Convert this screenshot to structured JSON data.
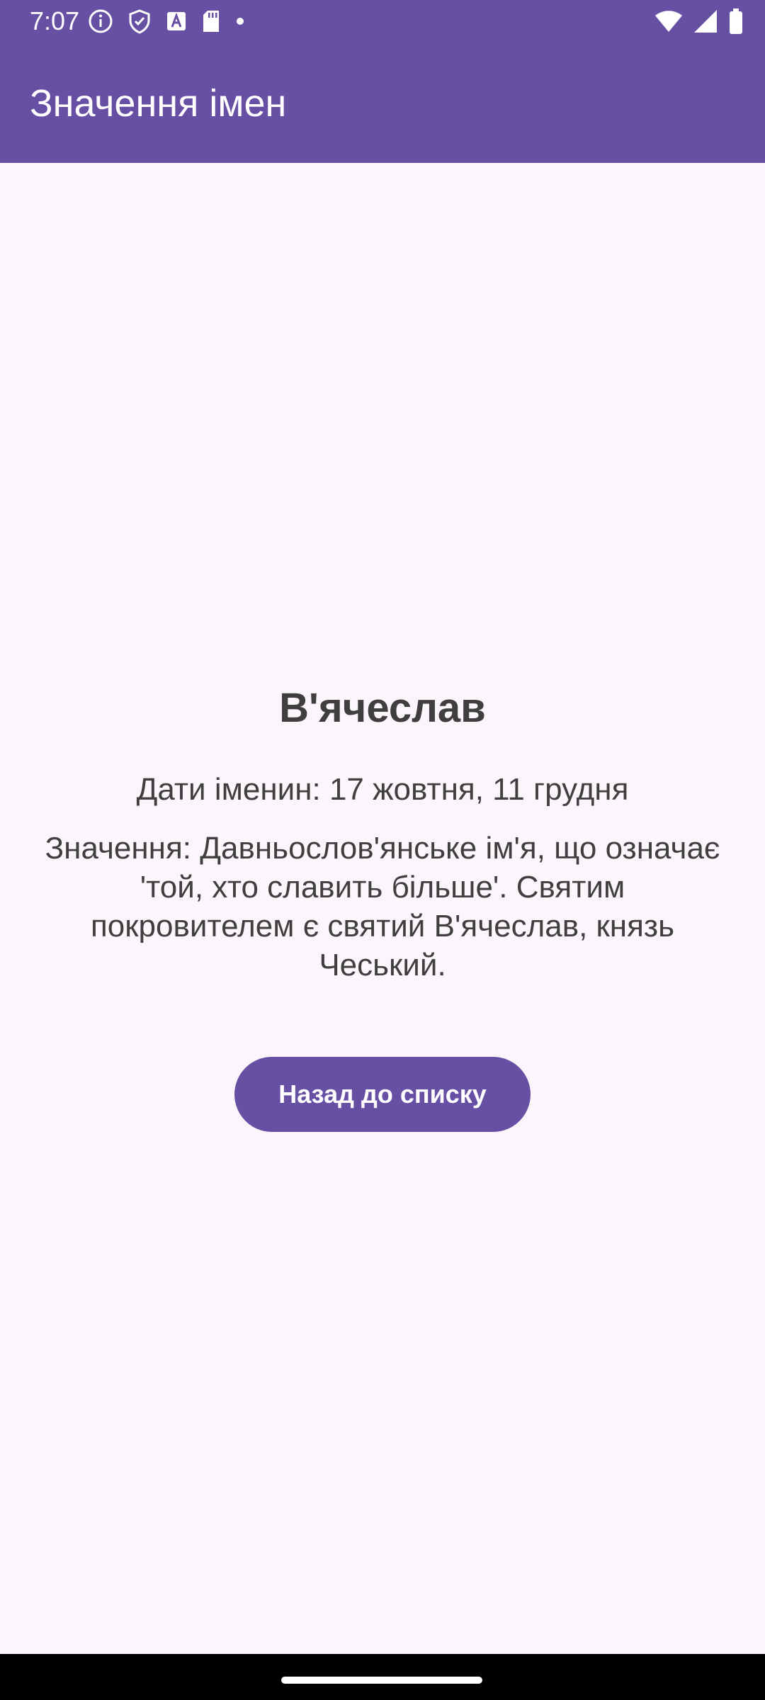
{
  "status_bar": {
    "time": "7:07",
    "left_icons": [
      "info-icon",
      "shield-icon",
      "a-text-icon",
      "sd-card-icon",
      "dot-icon"
    ],
    "right_icons": [
      "wifi-icon",
      "signal-icon",
      "battery-icon"
    ]
  },
  "app_bar": {
    "title": "Значення імен"
  },
  "detail": {
    "name": "В'ячеслав",
    "dates": "Дати іменин: 17 жовтня, 11 грудня",
    "meaning": "Значення: Давньослов'янське ім'я, що означає 'той, хто славить більше'. Святим покровителем є святий В'ячеслав, князь Чеський.",
    "back_button_label": "Назад до списку"
  },
  "colors": {
    "primary": "#6750A4",
    "background": "#FCF6FC",
    "text": "#3F3F3F"
  }
}
